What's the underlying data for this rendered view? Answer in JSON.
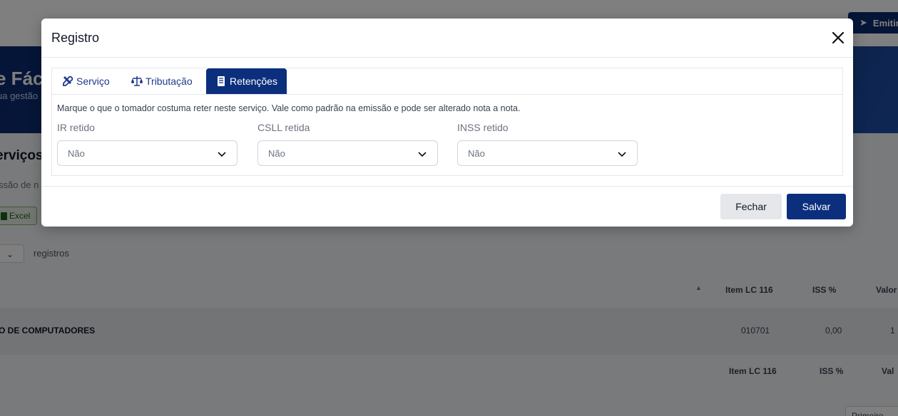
{
  "background": {
    "emit_label": "Emitir",
    "hero_title": "e Fáci",
    "hero_subtitle": "ua gestão",
    "section_title": "erviços",
    "section_subtitle": "ssão de n",
    "excel_label": "Excel",
    "registros_label": "registros",
    "table_headers": [
      "Item LC 116",
      "ISS %",
      "Valor"
    ],
    "row": {
      "description": "O DE COMPUTADORES",
      "item_lc": "010701",
      "iss": "0,00",
      "valor": "1"
    },
    "footer_headers": [
      "Item LC 116",
      "ISS %",
      "Val"
    ],
    "pager_label": "Primeiro"
  },
  "modal": {
    "title": "Registro",
    "tabs": [
      {
        "label": "Serviço",
        "icon": "tools-icon",
        "active": false
      },
      {
        "label": "Tributação",
        "icon": "scale-icon",
        "active": false
      },
      {
        "label": "Retenções",
        "icon": "receipt-icon",
        "active": true
      }
    ],
    "hint": "Marque o que o tomador costuma reter neste serviço. Vale como padrão na emissão e pode ser alterado nota a nota.",
    "fields": {
      "ir": {
        "label": "IR retido",
        "value": "Não"
      },
      "csll": {
        "label": "CSLL retida",
        "value": "Não"
      },
      "inss": {
        "label": "INSS retido",
        "value": "Não"
      }
    },
    "buttons": {
      "close_label": "Fechar",
      "save_label": "Salvar"
    }
  },
  "colors": {
    "primary": "#0b2f7d",
    "overlay": "rgba(0,0,0,0.5)"
  }
}
